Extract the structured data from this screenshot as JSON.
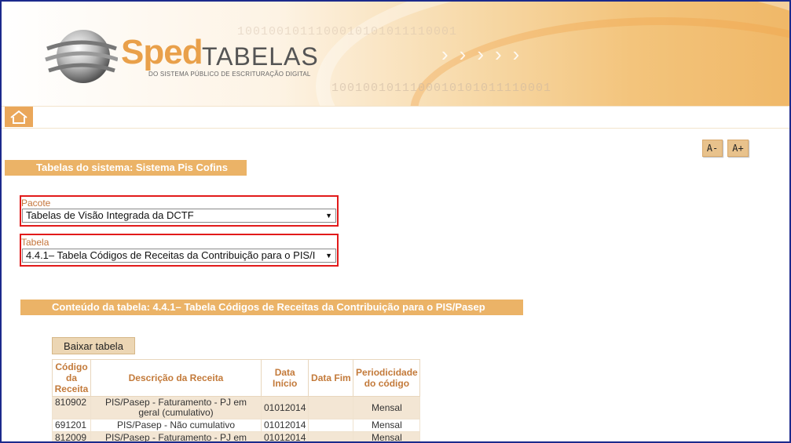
{
  "header": {
    "logo_sped": "Sped",
    "logo_tabelas": "TABELAS",
    "logo_subtitle": "DO SISTEMA PÚBLICO DE ESCRITURAÇÃO DIGITAL",
    "binary_1": "1001001011100010101011110001",
    "binary_2": "1001001011100010101011110001"
  },
  "nav": {
    "home_icon": "home-icon"
  },
  "font_controls": {
    "decrease": "A-",
    "increase": "A+"
  },
  "system_title": "Tabelas do sistema: Sistema Pis Cofins",
  "pacote": {
    "label": "Pacote",
    "selected": "Tabelas de Visão Integrada da DCTF"
  },
  "tabela": {
    "label": "Tabela",
    "selected": "4.4.1– Tabela Códigos de Receitas da Contribuição para o PIS/I"
  },
  "content_title": "Conteúdo da tabela: 4.4.1– Tabela Códigos de Receitas da Contribuição para o PIS/Pasep",
  "download_button": "Baixar tabela",
  "table": {
    "headers": [
      "Código da Receita",
      "Descrição da Receita",
      "Data Início",
      "Data Fim",
      "Periodicidade do código"
    ],
    "rows": [
      {
        "codigo": "810902",
        "descricao": "PIS/Pasep - Faturamento - PJ em geral (cumulativo)",
        "inicio": "01012014",
        "fim": "",
        "periodicidade": "Mensal"
      },
      {
        "codigo": "691201",
        "descricao": "PIS/Pasep - Não cumulativo",
        "inicio": "01012014",
        "fim": "",
        "periodicidade": "Mensal"
      },
      {
        "codigo": "812009",
        "descricao": "PIS/Pasep - Faturamento - PJ em geral",
        "inicio": "01012014",
        "fim": "",
        "periodicidade": "Mensal"
      }
    ]
  },
  "colors": {
    "accent": "#ebb367",
    "header_text": "#c37a3a",
    "highlight_border": "#e21a1a"
  }
}
